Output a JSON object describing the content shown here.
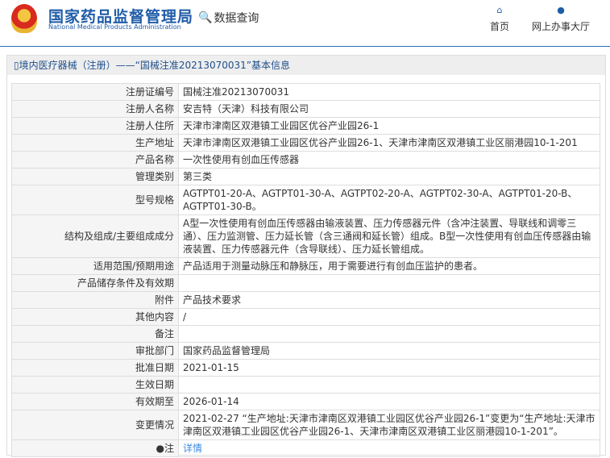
{
  "header": {
    "logo_cn": "国家药品监督管理局",
    "logo_en": "National Medical Products Administration",
    "data_query": "数据查询",
    "nav": [
      {
        "label": "首页",
        "icon": "home-icon"
      },
      {
        "label": "网上办事大厅",
        "icon": "user-icon"
      }
    ]
  },
  "panel": {
    "title": "境内医疗器械（注册）——“国械注准20213070031”基本信息"
  },
  "rows": [
    {
      "label": "注册证编号",
      "value": "国械注准20213070031"
    },
    {
      "label": "注册人名称",
      "value": "安吉特（天津）科技有限公司"
    },
    {
      "label": "注册人住所",
      "value": "天津市津南区双港镇工业园区优谷产业园26-1"
    },
    {
      "label": "生产地址",
      "value": "天津市津南区双港镇工业园区优谷产业园26-1、天津市津南区双港镇工业区丽港园10-1-201"
    },
    {
      "label": "产品名称",
      "value": "一次性使用有创血压传感器"
    },
    {
      "label": "管理类别",
      "value": "第三类"
    },
    {
      "label": "型号规格",
      "value": "AGTPT01-20-A、AGTPT01-30-A、AGTPT02-20-A、AGTPT02-30-A、AGTPT01-20-B、AGTPT01-30-B。"
    },
    {
      "label": "结构及组成/主要组成成分",
      "value": "A型一次性使用有创血压传感器由输液装置、压力传感器元件（含冲注装置、导联线和调零三通）、压力监测管、压力延长管（含三通阀和延长管）组成。B型一次性使用有创血压传感器由输液装置、压力传感器元件（含导联线）、压力延长管组成。"
    },
    {
      "label": "适用范围/预期用途",
      "value": "产品适用于测量动脉压和静脉压，用于需要进行有创血压监护的患者。"
    },
    {
      "label": "产品储存条件及有效期",
      "value": ""
    },
    {
      "label": "附件",
      "value": "产品技术要求"
    },
    {
      "label": "其他内容",
      "value": "/"
    },
    {
      "label": "备注",
      "value": ""
    },
    {
      "label": "审批部门",
      "value": "国家药品监督管理局"
    },
    {
      "label": "批准日期",
      "value": "2021-01-15"
    },
    {
      "label": "生效日期",
      "value": ""
    },
    {
      "label": "有效期至",
      "value": "2026-01-14"
    },
    {
      "label": "变更情况",
      "value": "2021-02-27 “生产地址:天津市津南区双港镇工业园区优谷产业园26-1”变更为“生产地址:天津市津南区双港镇工业园区优谷产业园26-1、天津市津南区双港镇工业区丽港园10-1-201”。"
    }
  ],
  "note": {
    "label": "注",
    "link": "详情"
  }
}
